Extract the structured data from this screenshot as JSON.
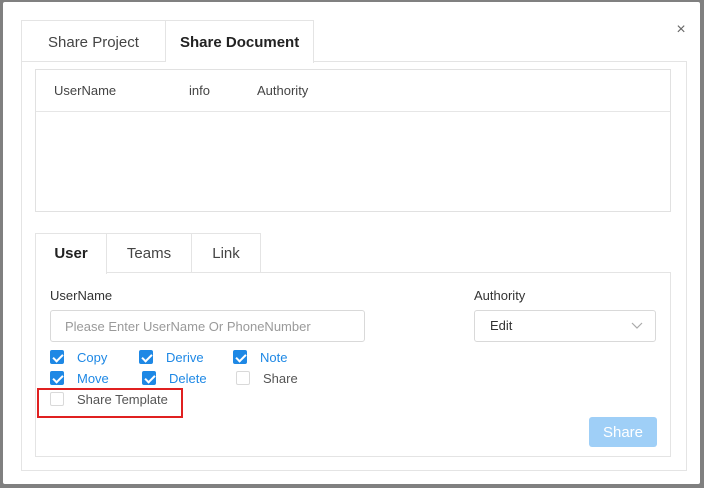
{
  "dialog": {
    "close_icon": "×",
    "tabs": [
      "Share Project",
      "Share Document"
    ],
    "active_tab": "Share Document"
  },
  "table": {
    "columns": [
      "UserName",
      "info",
      "Authority"
    ],
    "rows": []
  },
  "inner_tabs": [
    "User",
    "Teams",
    "Link"
  ],
  "form": {
    "username_label": "UserName",
    "username_placeholder": "Please Enter UserName Or PhoneNumber",
    "username_value": "",
    "authority_label": "Authority",
    "authority_value": "Edit"
  },
  "permissions": [
    {
      "label": "Copy",
      "checked": true
    },
    {
      "label": "Derive",
      "checked": true
    },
    {
      "label": "Note",
      "checked": true
    },
    {
      "label": "Move",
      "checked": true
    },
    {
      "label": "Delete",
      "checked": true
    },
    {
      "label": "Share",
      "checked": false
    },
    {
      "label": "Share Template",
      "checked": false
    }
  ],
  "share_button": "Share",
  "colors": {
    "accent": "#1e88e5",
    "disabled_button": "#9fcff7",
    "highlight": "#e02020"
  }
}
